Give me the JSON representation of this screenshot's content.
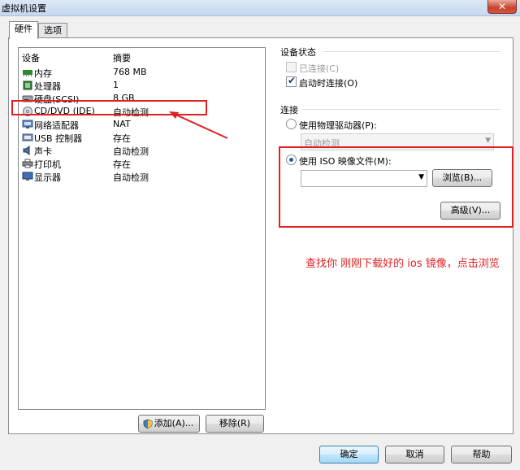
{
  "window": {
    "title": "虚拟机设置",
    "close_icon": "✕"
  },
  "tabs": [
    {
      "label": "硬件"
    },
    {
      "label": "选项"
    }
  ],
  "device_list": {
    "columns": {
      "device": "设备",
      "summary": "摘要"
    },
    "items": [
      {
        "name": "内存",
        "summary": "768 MB",
        "icon": "memory-icon"
      },
      {
        "name": "处理器",
        "summary": "1",
        "icon": "processor-icon"
      },
      {
        "name": "硬盘(SCSI)",
        "summary": "8 GB",
        "icon": "hard-disk-icon"
      },
      {
        "name": "CD/DVD (IDE)",
        "summary": "自动检测",
        "icon": "cd-dvd-icon"
      },
      {
        "name": "网络适配器",
        "summary": "NAT",
        "icon": "network-adapter-icon"
      },
      {
        "name": "USB 控制器",
        "summary": "存在",
        "icon": "usb-icon"
      },
      {
        "name": "声卡",
        "summary": "自动检测",
        "icon": "sound-card-icon"
      },
      {
        "name": "打印机",
        "summary": "存在",
        "icon": "printer-icon"
      },
      {
        "name": "显示器",
        "summary": "自动检测",
        "icon": "display-icon"
      }
    ],
    "selected_index": 3,
    "add_label": "添加(A)...",
    "remove_label": "移除(R)"
  },
  "device_status": {
    "title": "设备状态",
    "connected_label": "已连接(C)",
    "connected_checked": false,
    "connected_enabled": false,
    "connect_at_power_on_label": "启动时连接(O)",
    "connect_at_power_on_checked": true
  },
  "connection": {
    "title": "连接",
    "physical_drive_label": "使用物理驱动器(P):",
    "physical_drive_value": "自动检测",
    "iso_label": "使用 ISO 映像文件(M):",
    "iso_value": "",
    "browse_label": "浏览(B)...",
    "advanced_label": "高级(V)...",
    "selected_option": "iso"
  },
  "annotation": {
    "text": "查找你 刚刚下载好的 ios 镜像，点击浏览",
    "color": "#e02020"
  },
  "footer": {
    "ok_label": "确定",
    "cancel_label": "取消",
    "help_label": "帮助"
  }
}
